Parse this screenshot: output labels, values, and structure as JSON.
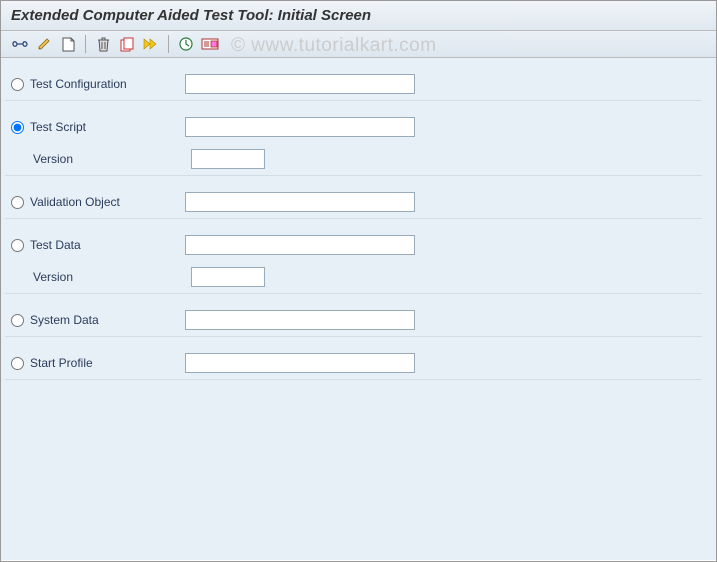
{
  "title": "Extended Computer Aided Test Tool: Initial Screen",
  "watermark": "© www.tutorialkart.com",
  "toolbar": {
    "display": "display-icon",
    "change": "pencil-icon",
    "create": "page-icon",
    "delete": "trash-icon",
    "copy": "copy-icon",
    "execute": "execute-icon",
    "schedule": "clock-icon",
    "log": "log-icon"
  },
  "fields": {
    "test_configuration": {
      "label": "Test Configuration",
      "value": ""
    },
    "test_script": {
      "label": "Test Script",
      "value": "",
      "version_label": "Version",
      "version_value": ""
    },
    "validation_object": {
      "label": "Validation Object",
      "value": ""
    },
    "test_data": {
      "label": "Test Data",
      "value": "",
      "version_label": "Version",
      "version_value": ""
    },
    "system_data": {
      "label": "System Data",
      "value": ""
    },
    "start_profile": {
      "label": "Start Profile",
      "value": ""
    }
  },
  "selected": "test_script"
}
